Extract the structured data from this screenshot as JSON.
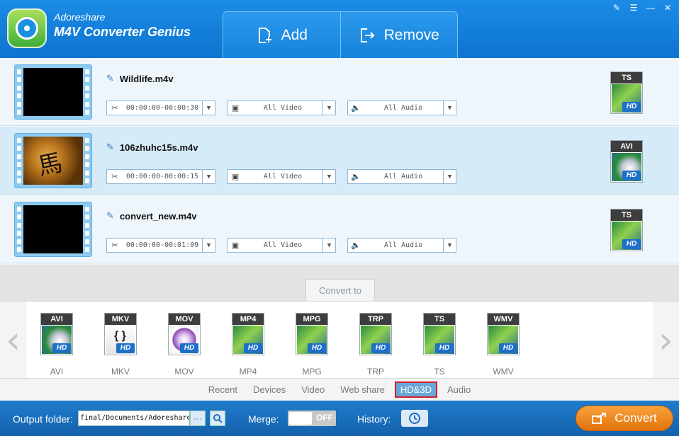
{
  "app": {
    "brand_top": "Adoreshare",
    "brand_main": "M4V Converter Genius",
    "accent_color": "#1683dc",
    "convert_color": "#f08a1c"
  },
  "toolbar": {
    "add_label": "Add",
    "remove_label": "Remove"
  },
  "files": [
    {
      "name": "Wildlife.m4v",
      "time": "00:00:00-00:00:30",
      "video": "All Video",
      "audio": "All Audio",
      "format": "TS",
      "thumb": "black"
    },
    {
      "name": "106zhuhc15s.m4v",
      "time": "00:00:00-00:00:15",
      "video": "All Video",
      "audio": "All Audio",
      "format": "AVI",
      "thumb": "image"
    },
    {
      "name": "convert_new.m4v",
      "time": "00:00:00-00:01:09",
      "video": "All Video",
      "audio": "All Audio",
      "format": "TS",
      "thumb": "black"
    }
  ],
  "convert_to": {
    "tab_label": "Convert to",
    "formats": [
      {
        "label": "AVI",
        "badge": "AVI",
        "hd": "HD"
      },
      {
        "label": "MKV",
        "badge": "MKV",
        "hd": "HD"
      },
      {
        "label": "MOV",
        "badge": "MOV",
        "hd": "HD"
      },
      {
        "label": "MP4",
        "badge": "MP4",
        "hd": "HD"
      },
      {
        "label": "MPG",
        "badge": "MPG",
        "hd": "HD"
      },
      {
        "label": "TRP",
        "badge": "TRP",
        "hd": "HD"
      },
      {
        "label": "TS",
        "badge": "TS",
        "hd": "HD"
      },
      {
        "label": "WMV",
        "badge": "WMV",
        "hd": "HD"
      }
    ],
    "categories": [
      "Recent",
      "Devices",
      "Video",
      "Web share",
      "HD&3D",
      "Audio"
    ],
    "active_category": "HD&3D"
  },
  "bottom": {
    "output_label": "Output folder:",
    "output_value": "final/Documents/Adoreshare",
    "browse_label": "···",
    "merge_label": "Merge:",
    "merge_state": "OFF",
    "history_label": "History:",
    "convert_label": "Convert"
  }
}
